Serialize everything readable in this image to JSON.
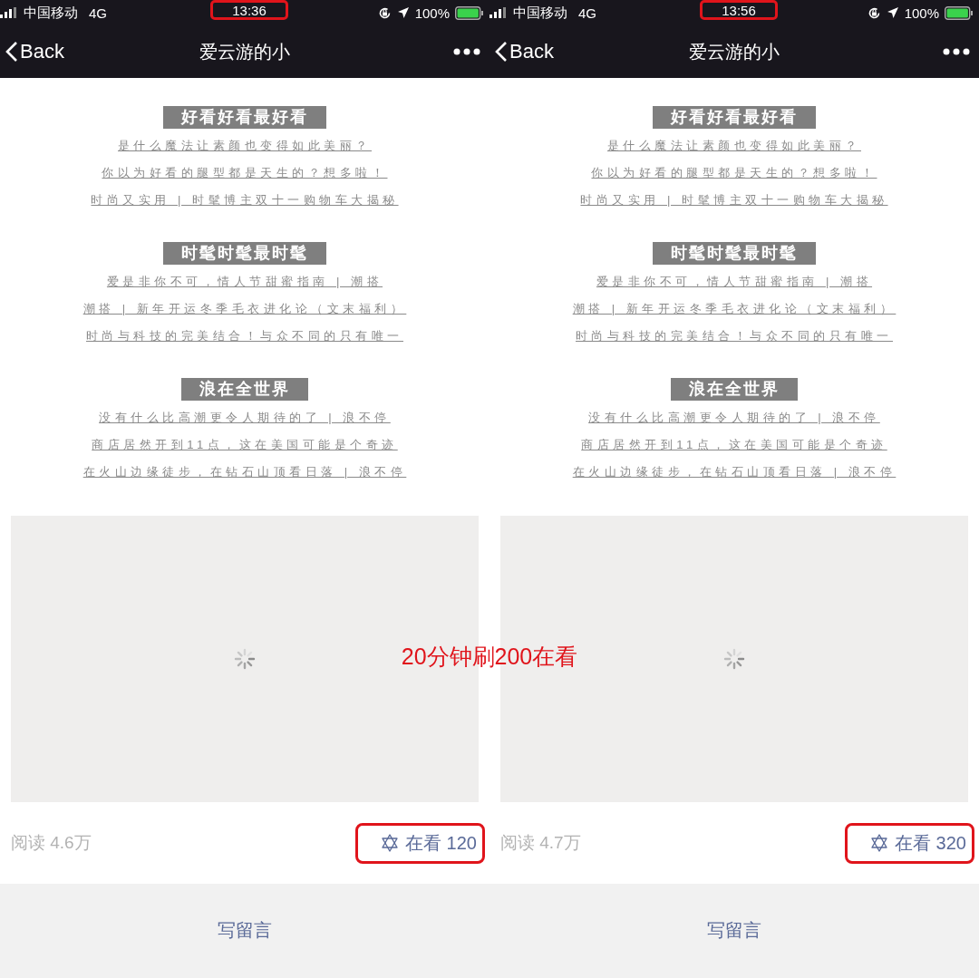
{
  "phones": [
    {
      "status_bar": {
        "carrier": "中国移动",
        "network": "4G",
        "time": "13:36",
        "time_highlighted": true,
        "battery": "100%"
      },
      "nav": {
        "back": "Back",
        "title": "爱云游的小"
      },
      "sections": [
        {
          "heading": "好看好看最好看",
          "links": [
            "是什么魔法让素颜也变得如此美丽？",
            "你以为好看的腿型都是天生的？想多啦！",
            "时尚又实用 | 时髦博主双十一购物车大揭秘"
          ]
        },
        {
          "heading": "时髦时髦最时髦",
          "links": [
            "爱是非你不可，情人节甜蜜指南 | 潮搭",
            "潮搭 | 新年开运冬季毛衣进化论（文末福利）",
            "时尚与科技的完美结合！与众不同的只有唯一"
          ]
        },
        {
          "heading": "浪在全世界",
          "links": [
            "没有什么比高潮更令人期待的了 | 浪不停",
            "商店居然开到11点，这在美国可能是个奇迹",
            "在火山边缘徒步，在钻石山顶看日落 | 浪不停"
          ]
        }
      ],
      "reads": "阅读 4.6万",
      "watch": {
        "label": "在看 120",
        "highlighted": true
      },
      "comment_button": "写留言"
    },
    {
      "status_bar": {
        "carrier": "中国移动",
        "network": "4G",
        "time": "13:56",
        "time_highlighted": true,
        "battery": "100%"
      },
      "nav": {
        "back": "Back",
        "title": "爱云游的小"
      },
      "sections": [
        {
          "heading": "好看好看最好看",
          "links": [
            "是什么魔法让素颜也变得如此美丽？",
            "你以为好看的腿型都是天生的？想多啦！",
            "时尚又实用 | 时髦博主双十一购物车大揭秘"
          ]
        },
        {
          "heading": "时髦时髦最时髦",
          "links": [
            "爱是非你不可，情人节甜蜜指南 | 潮搭",
            "潮搭 | 新年开运冬季毛衣进化论（文末福利）",
            "时尚与科技的完美结合！与众不同的只有唯一"
          ]
        },
        {
          "heading": "浪在全世界",
          "links": [
            "没有什么比高潮更令人期待的了 | 浪不停",
            "商店居然开到11点，这在美国可能是个奇迹",
            "在火山边缘徒步，在钻石山顶看日落 | 浪不停"
          ]
        }
      ],
      "reads": "阅读 4.7万",
      "watch": {
        "label": "在看 320",
        "highlighted": true
      },
      "comment_button": "写留言"
    }
  ],
  "annotation": "20分钟刷200在看"
}
